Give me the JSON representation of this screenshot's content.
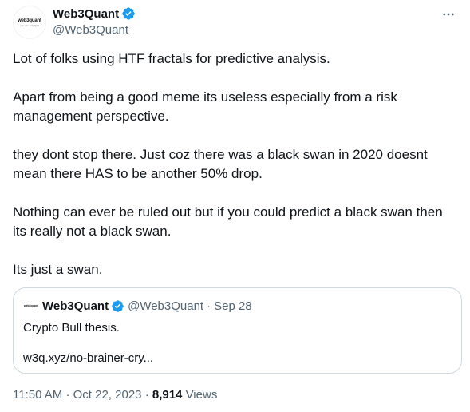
{
  "author": {
    "display_name": "Web3Quant",
    "handle": "@Web3Quant",
    "avatar_word": "web3quant",
    "avatar_tagline": "you can only fight"
  },
  "tweet": {
    "paragraphs": [
      "Lot of folks using HTF fractals for predictive analysis.",
      "Apart from being a good meme its useless especially from a risk management perspective.",
      "they dont stop there. Just coz there was a black swan in 2020 doesnt mean there HAS to be another 50% drop.",
      "Nothing can ever be ruled out but if you could predict a black swan then its really not a black swan.",
      "Its just a swan."
    ]
  },
  "quote": {
    "display_name": "Web3Quant",
    "handle": "@Web3Quant",
    "separator": "·",
    "date": "Sep 28",
    "text": "Crypto Bull thesis.",
    "link": "w3q.xyz/no-brainer-cry..."
  },
  "meta": {
    "time": "11:50 AM",
    "separator": "·",
    "date": "Oct 22, 2023",
    "views_count": "8,914",
    "views_label": "Views"
  },
  "icons": {
    "verified": "verified-badge-icon",
    "more": "more-horizontal-icon"
  },
  "colors": {
    "verified_blue": "#1d9bf0",
    "secondary_text": "#536471",
    "border": "#cfd9de"
  }
}
